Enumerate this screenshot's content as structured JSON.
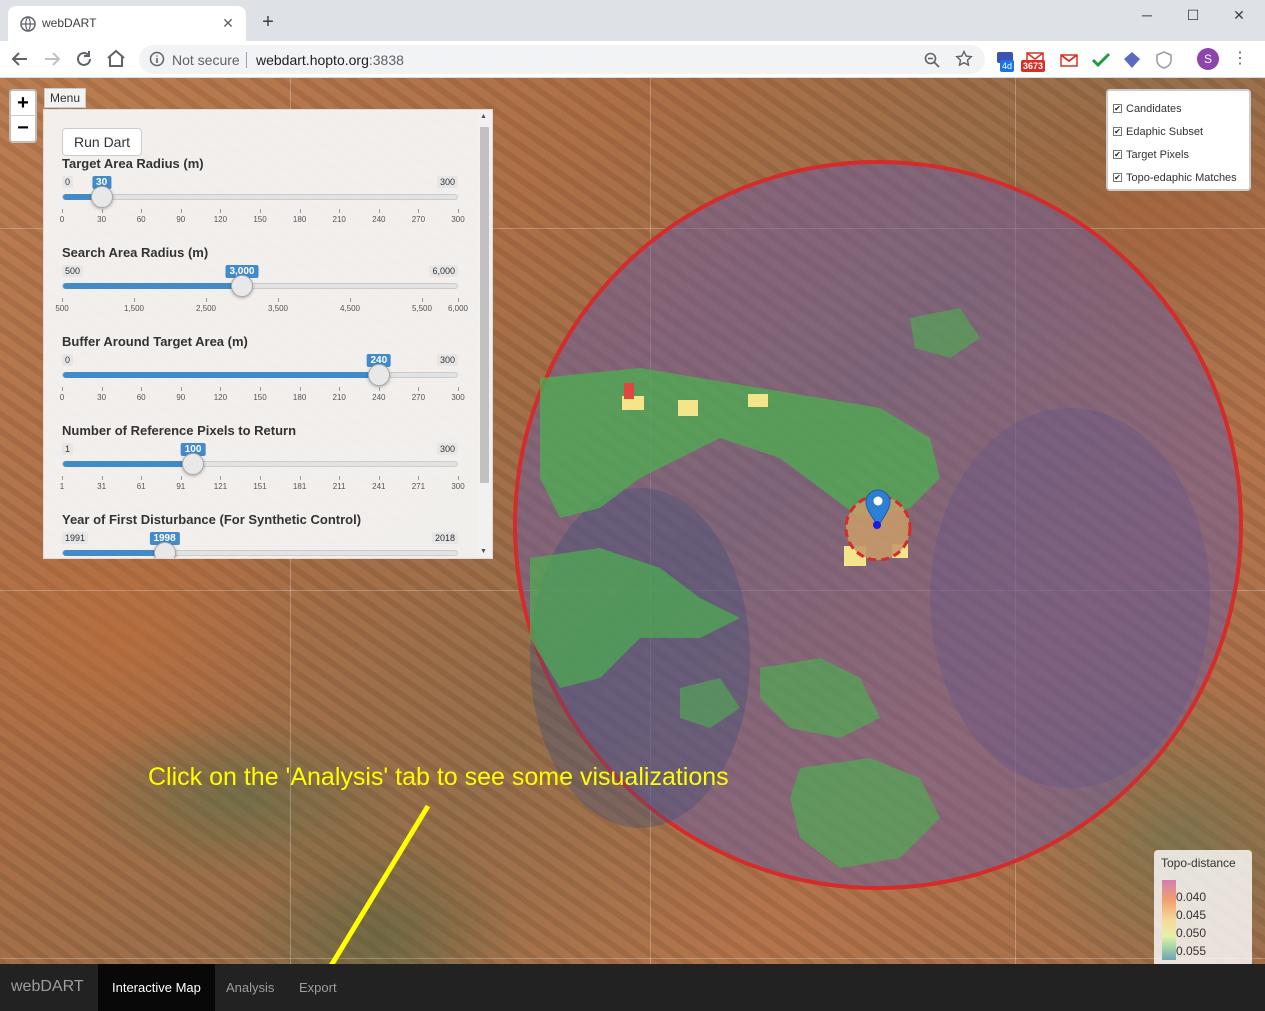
{
  "browser": {
    "tab_title": "webDART",
    "security_label": "Not secure",
    "url_host": "webdart.hopto.org",
    "url_port": ":3838",
    "ext_badge_4d": "4d",
    "ext_badge_gmail": "3673",
    "avatar_initial": "S"
  },
  "menu": {
    "tab_label": "Menu",
    "run_button": "Run Dart"
  },
  "sliders": [
    {
      "label": "Target Area Radius (m)",
      "min": "0",
      "max": "300",
      "value": "30",
      "fraction": 0.1,
      "ticks": [
        "0",
        "30",
        "60",
        "90",
        "120",
        "150",
        "180",
        "210",
        "240",
        "270",
        "300"
      ]
    },
    {
      "label": "Search Area Radius (m)",
      "min": "500",
      "max": "6,000",
      "value": "3,000",
      "fraction": 0.4545,
      "ticks": [
        "500",
        "1,500",
        "2,500",
        "3,500",
        "4,500",
        "5,500",
        "6,000"
      ]
    },
    {
      "label": "Buffer Around Target Area (m)",
      "min": "0",
      "max": "300",
      "value": "240",
      "fraction": 0.8,
      "ticks": [
        "0",
        "30",
        "60",
        "90",
        "120",
        "150",
        "180",
        "210",
        "240",
        "270",
        "300"
      ]
    },
    {
      "label": "Number of Reference Pixels to Return",
      "min": "1",
      "max": "300",
      "value": "100",
      "fraction": 0.331,
      "ticks": [
        "1",
        "31",
        "61",
        "91",
        "121",
        "151",
        "181",
        "211",
        "241",
        "271",
        "300"
      ]
    },
    {
      "label": "Year of First Disturbance (For Synthetic Control)",
      "min": "1991",
      "max": "2018",
      "value": "1998",
      "fraction": 0.259,
      "ticks": []
    }
  ],
  "layers": [
    {
      "label": "Candidates",
      "checked": true
    },
    {
      "label": "Edaphic Subset",
      "checked": true
    },
    {
      "label": "Target Pixels",
      "checked": true
    },
    {
      "label": "Topo-edaphic Matches",
      "checked": true
    }
  ],
  "legend": {
    "title": "Topo-distance",
    "labels": [
      "0.040",
      "0.045",
      "0.050",
      "0.055"
    ]
  },
  "annotation": "Click on the 'Analysis' tab to see some visualizations",
  "navbar": {
    "brand": "webDART",
    "tabs": [
      {
        "label": "Interactive Map",
        "active": true
      },
      {
        "label": "Analysis",
        "active": false
      },
      {
        "label": "Export",
        "active": false
      }
    ]
  },
  "colors": {
    "search_circle": "#d42b2b",
    "search_fill": "#7a6aa0",
    "matches": "#4caf50",
    "marker": "#2d7fd6",
    "annotation": "#ffff00",
    "slider": "#428bca"
  }
}
